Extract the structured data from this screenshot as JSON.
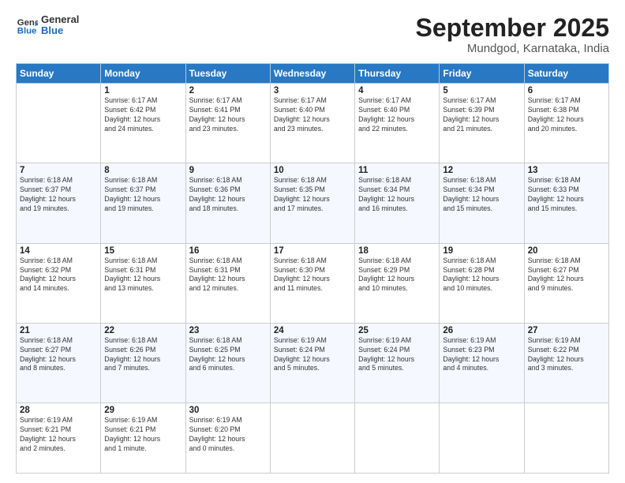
{
  "header": {
    "logo_line1": "General",
    "logo_line2": "Blue",
    "month": "September 2025",
    "location": "Mundgod, Karnataka, India"
  },
  "weekdays": [
    "Sunday",
    "Monday",
    "Tuesday",
    "Wednesday",
    "Thursday",
    "Friday",
    "Saturday"
  ],
  "weeks": [
    [
      {
        "num": "",
        "info": ""
      },
      {
        "num": "1",
        "info": "Sunrise: 6:17 AM\nSunset: 6:42 PM\nDaylight: 12 hours\nand 24 minutes."
      },
      {
        "num": "2",
        "info": "Sunrise: 6:17 AM\nSunset: 6:41 PM\nDaylight: 12 hours\nand 23 minutes."
      },
      {
        "num": "3",
        "info": "Sunrise: 6:17 AM\nSunset: 6:40 PM\nDaylight: 12 hours\nand 23 minutes."
      },
      {
        "num": "4",
        "info": "Sunrise: 6:17 AM\nSunset: 6:40 PM\nDaylight: 12 hours\nand 22 minutes."
      },
      {
        "num": "5",
        "info": "Sunrise: 6:17 AM\nSunset: 6:39 PM\nDaylight: 12 hours\nand 21 minutes."
      },
      {
        "num": "6",
        "info": "Sunrise: 6:17 AM\nSunset: 6:38 PM\nDaylight: 12 hours\nand 20 minutes."
      }
    ],
    [
      {
        "num": "7",
        "info": "Sunrise: 6:18 AM\nSunset: 6:37 PM\nDaylight: 12 hours\nand 19 minutes."
      },
      {
        "num": "8",
        "info": "Sunrise: 6:18 AM\nSunset: 6:37 PM\nDaylight: 12 hours\nand 19 minutes."
      },
      {
        "num": "9",
        "info": "Sunrise: 6:18 AM\nSunset: 6:36 PM\nDaylight: 12 hours\nand 18 minutes."
      },
      {
        "num": "10",
        "info": "Sunrise: 6:18 AM\nSunset: 6:35 PM\nDaylight: 12 hours\nand 17 minutes."
      },
      {
        "num": "11",
        "info": "Sunrise: 6:18 AM\nSunset: 6:34 PM\nDaylight: 12 hours\nand 16 minutes."
      },
      {
        "num": "12",
        "info": "Sunrise: 6:18 AM\nSunset: 6:34 PM\nDaylight: 12 hours\nand 15 minutes."
      },
      {
        "num": "13",
        "info": "Sunrise: 6:18 AM\nSunset: 6:33 PM\nDaylight: 12 hours\nand 15 minutes."
      }
    ],
    [
      {
        "num": "14",
        "info": "Sunrise: 6:18 AM\nSunset: 6:32 PM\nDaylight: 12 hours\nand 14 minutes."
      },
      {
        "num": "15",
        "info": "Sunrise: 6:18 AM\nSunset: 6:31 PM\nDaylight: 12 hours\nand 13 minutes."
      },
      {
        "num": "16",
        "info": "Sunrise: 6:18 AM\nSunset: 6:31 PM\nDaylight: 12 hours\nand 12 minutes."
      },
      {
        "num": "17",
        "info": "Sunrise: 6:18 AM\nSunset: 6:30 PM\nDaylight: 12 hours\nand 11 minutes."
      },
      {
        "num": "18",
        "info": "Sunrise: 6:18 AM\nSunset: 6:29 PM\nDaylight: 12 hours\nand 10 minutes."
      },
      {
        "num": "19",
        "info": "Sunrise: 6:18 AM\nSunset: 6:28 PM\nDaylight: 12 hours\nand 10 minutes."
      },
      {
        "num": "20",
        "info": "Sunrise: 6:18 AM\nSunset: 6:27 PM\nDaylight: 12 hours\nand 9 minutes."
      }
    ],
    [
      {
        "num": "21",
        "info": "Sunrise: 6:18 AM\nSunset: 6:27 PM\nDaylight: 12 hours\nand 8 minutes."
      },
      {
        "num": "22",
        "info": "Sunrise: 6:18 AM\nSunset: 6:26 PM\nDaylight: 12 hours\nand 7 minutes."
      },
      {
        "num": "23",
        "info": "Sunrise: 6:18 AM\nSunset: 6:25 PM\nDaylight: 12 hours\nand 6 minutes."
      },
      {
        "num": "24",
        "info": "Sunrise: 6:19 AM\nSunset: 6:24 PM\nDaylight: 12 hours\nand 5 minutes."
      },
      {
        "num": "25",
        "info": "Sunrise: 6:19 AM\nSunset: 6:24 PM\nDaylight: 12 hours\nand 5 minutes."
      },
      {
        "num": "26",
        "info": "Sunrise: 6:19 AM\nSunset: 6:23 PM\nDaylight: 12 hours\nand 4 minutes."
      },
      {
        "num": "27",
        "info": "Sunrise: 6:19 AM\nSunset: 6:22 PM\nDaylight: 12 hours\nand 3 minutes."
      }
    ],
    [
      {
        "num": "28",
        "info": "Sunrise: 6:19 AM\nSunset: 6:21 PM\nDaylight: 12 hours\nand 2 minutes."
      },
      {
        "num": "29",
        "info": "Sunrise: 6:19 AM\nSunset: 6:21 PM\nDaylight: 12 hours\nand 1 minute."
      },
      {
        "num": "30",
        "info": "Sunrise: 6:19 AM\nSunset: 6:20 PM\nDaylight: 12 hours\nand 0 minutes."
      },
      {
        "num": "",
        "info": ""
      },
      {
        "num": "",
        "info": ""
      },
      {
        "num": "",
        "info": ""
      },
      {
        "num": "",
        "info": ""
      }
    ]
  ]
}
